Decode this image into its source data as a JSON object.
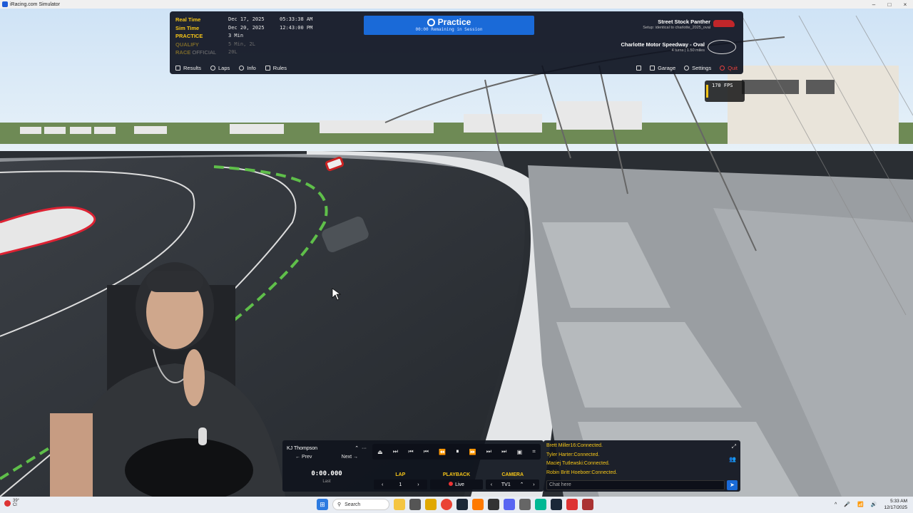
{
  "window": {
    "title": "iRacing.com Simulator",
    "minimize": "–",
    "maximize": "□",
    "close": "×"
  },
  "session": {
    "rows": [
      {
        "label": "Real Time",
        "v1": "Dec 17, 2025",
        "v2": "05:33:38 AM",
        "dim": false
      },
      {
        "label": "Sim Time",
        "v1": "Dec 20, 2025",
        "v2": "12:43:00 PM",
        "dim": false
      },
      {
        "label": "PRACTICE",
        "v1": "3 Min",
        "v2": "",
        "dim": false
      },
      {
        "label": "QUALIFY",
        "v1": "5 Min, 2L",
        "v2": "",
        "dim": true
      },
      {
        "label": "RACE",
        "label_extra": "OFFICIAL",
        "v1": "20L",
        "v2": "",
        "dim": true
      }
    ]
  },
  "banner": {
    "title": "Practice",
    "subtitle": "00:00 Remaining in Session"
  },
  "car": {
    "name": "Street Stock Panther",
    "setup": "Setup: identical to charlotte_2025_oval",
    "color": "#c0262a"
  },
  "track": {
    "name": "Charlotte Motor Speedway - Oval",
    "details": "4 turns | 1.50 miles"
  },
  "menu_left": [
    {
      "label": "Results",
      "icon": "trophy-icon"
    },
    {
      "label": "Laps",
      "icon": "laps-icon"
    },
    {
      "label": "Info",
      "icon": "info-icon"
    },
    {
      "label": "Rules",
      "icon": "rules-icon"
    }
  ],
  "menu_right": [
    {
      "label": "",
      "icon": "pencil-icon"
    },
    {
      "label": "Garage",
      "icon": "wrench-icon"
    },
    {
      "label": "Settings",
      "icon": "gear-icon"
    },
    {
      "label": "Quit",
      "icon": "power-icon"
    }
  ],
  "fps": {
    "label": "170 FPS"
  },
  "replay": {
    "driver": "KJ Thompson",
    "driver_caret": "⌃",
    "driver_more": "···",
    "prev": "← Prev",
    "next": "Next →",
    "time": "0:00.000",
    "time_label": "Last",
    "lap_label": "LAP",
    "lap_value": "1",
    "playback_label": "PLAYBACK",
    "playback_value": "Live",
    "camera_label": "CAMERA",
    "camera_value": "TV1",
    "controls": [
      "⏏",
      "⏭",
      "⏮",
      "⏮",
      "⏪",
      "⏸",
      "⏩",
      "⏭",
      "⏭",
      "▣",
      "⌗"
    ]
  },
  "chat": {
    "messages": [
      "Brett Miller16:Connected.",
      "Tyler Harter:Connected.",
      "Maciej Tutlewski:Connected.",
      "Robin Britt Hoeboer:Connected."
    ],
    "placeholder": "Chat here",
    "send": "➤",
    "expand": "⤢",
    "people": "👥"
  },
  "taskbar": {
    "weather_temp": "39°",
    "weather_text": "Cl",
    "search": "Search",
    "time": "5:33 AM",
    "date": "12/17/2025",
    "tray_up": "^",
    "tray_mic": "🎤",
    "tray_net": "📶",
    "tray_vol": "🔊"
  }
}
